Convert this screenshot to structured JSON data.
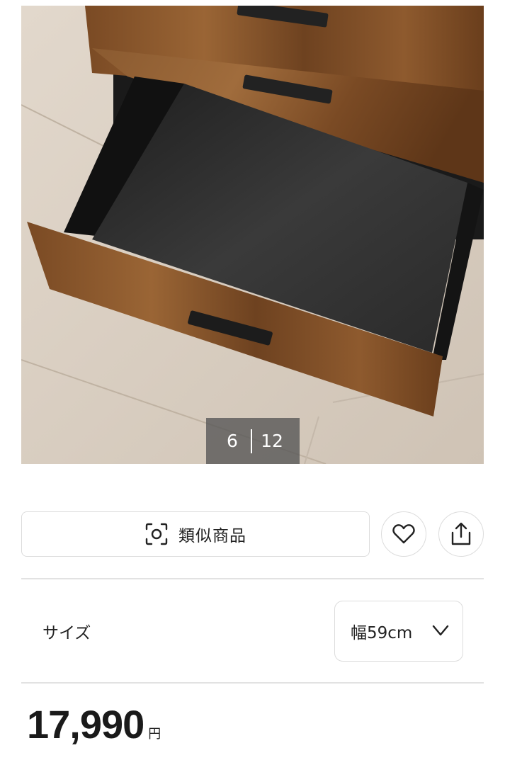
{
  "gallery": {
    "current": "6",
    "total": "12",
    "image_alt": "wooden drawer"
  },
  "actions": {
    "similar_label": "類似商品",
    "similar_icon": "camera-scan-icon",
    "favorite_icon": "heart-icon",
    "share_icon": "share-icon"
  },
  "size": {
    "label": "サイズ",
    "selected": "幅59cm",
    "dropdown_icon": "chevron-down-icon"
  },
  "price": {
    "amount": "17,990",
    "unit": "円"
  },
  "colors": {
    "border": "#dcdcdc",
    "text": "#222222",
    "counter_bg": "#555555"
  }
}
